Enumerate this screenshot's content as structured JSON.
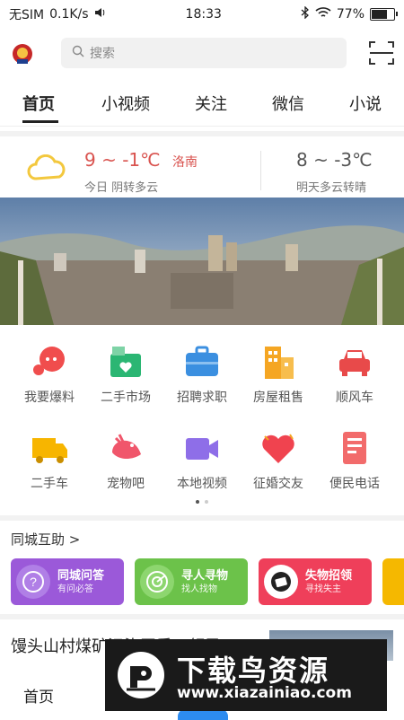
{
  "status": {
    "carrier": "无SIM",
    "speed": "0.1K/s",
    "time": "18:33",
    "battery": "77%",
    "battery_level": 0.77
  },
  "search": {
    "placeholder": "搜索"
  },
  "tabs": [
    {
      "label": "首页"
    },
    {
      "label": "小视频"
    },
    {
      "label": "关注"
    },
    {
      "label": "微信"
    },
    {
      "label": "小说"
    }
  ],
  "weather": {
    "today_temp": "9 ~ -1℃",
    "city": "洛南",
    "today_desc": "今日 阴转多云",
    "tomorrow_temp": "8 ~ -3℃",
    "tomorrow_desc": "明天多云转晴"
  },
  "services": [
    {
      "label": "我要爆料",
      "icon": "chat-bubble-icon",
      "color": "#f04d4d"
    },
    {
      "label": "二手市场",
      "icon": "shopping-basket-icon",
      "color": "#2bb673"
    },
    {
      "label": "招聘求职",
      "icon": "briefcase-icon",
      "color": "#3b8fe0"
    },
    {
      "label": "房屋租售",
      "icon": "building-icon",
      "color": "#f5a623"
    },
    {
      "label": "顺风车",
      "icon": "car-icon",
      "color": "#e84a4a"
    },
    {
      "label": "二手车",
      "icon": "truck-icon",
      "color": "#f7b500"
    },
    {
      "label": "宠物吧",
      "icon": "bird-icon",
      "color": "#f0566b"
    },
    {
      "label": "本地视频",
      "icon": "video-camera-icon",
      "color": "#8e6ee8"
    },
    {
      "label": "征婚交友",
      "icon": "heart-icon",
      "color": "#f0434f"
    },
    {
      "label": "便民电话",
      "icon": "phonebook-icon",
      "color": "#f26b6b"
    }
  ],
  "community": {
    "title": "同城互助 >",
    "cards": [
      {
        "title": "同城问答",
        "subtitle": "有问必答",
        "color": "#9b59d9"
      },
      {
        "title": "寻人寻物",
        "subtitle": "找人找物",
        "color": "#6cc24a"
      },
      {
        "title": "失物招领",
        "subtitle": "寻找失主",
        "color": "#ef3f5a"
      }
    ]
  },
  "news": {
    "headline": "馒头山村煤矿污染严重，领导"
  },
  "bottom_nav": {
    "home": "首页"
  },
  "watermark": {
    "title": "下载鸟资源",
    "url": "www.xiazainiao.com"
  }
}
